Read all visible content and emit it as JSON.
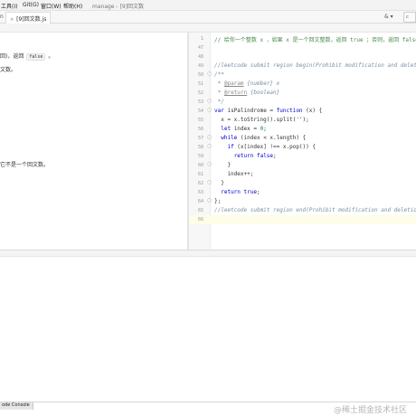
{
  "menubar": {
    "items": [
      "工具(I)",
      "Git(G)",
      "窗口(W)",
      "帮助(H)"
    ],
    "window_title": "manage - [9]回文数"
  },
  "tabbar": {
    "nav_arrow": "n",
    "active_tab": "[9]回文数.js",
    "user_menu": "&",
    "right_button": "c"
  },
  "description": {
    "line1_before": "回)，返回",
    "line1_code": "false",
    "line1_after": "。",
    "line2": "文数。",
    "line3": "它不是一个回文数。"
  },
  "editor": {
    "active_line_number": "66",
    "lines": [
      {
        "num": "1",
        "fold": false,
        "tokens": [
          {
            "t": "// 给你一个整数 x ，如果 x 是一个回文整数，返回 true ；否则，返回 false 。",
            "c": "tok-comment-cn"
          }
        ]
      },
      {
        "num": "47",
        "fold": false,
        "tokens": []
      },
      {
        "num": "48",
        "fold": false,
        "tokens": []
      },
      {
        "num": "49",
        "fold": false,
        "tokens": [
          {
            "t": "//leetcode submit region begin(Prohibit modification and deletion)",
            "c": "tok-comment"
          }
        ]
      },
      {
        "num": "50",
        "fold": true,
        "tokens": [
          {
            "t": "/**",
            "c": "tok-comment"
          }
        ]
      },
      {
        "num": "51",
        "fold": false,
        "tokens": [
          {
            "t": " * ",
            "c": "tok-comment"
          },
          {
            "t": "@param",
            "c": "tok-tag"
          },
          {
            "t": " {number} x",
            "c": "tok-comment"
          }
        ]
      },
      {
        "num": "52",
        "fold": false,
        "tokens": [
          {
            "t": " * ",
            "c": "tok-comment"
          },
          {
            "t": "@return",
            "c": "tok-tag"
          },
          {
            "t": " {boolean}",
            "c": "tok-comment"
          }
        ]
      },
      {
        "num": "53",
        "fold": true,
        "tokens": [
          {
            "t": " */",
            "c": "tok-comment"
          }
        ]
      },
      {
        "num": "54",
        "fold": true,
        "tokens": [
          {
            "t": "var ",
            "c": "tok-keyword"
          },
          {
            "t": "isPalindrome = ",
            "c": ""
          },
          {
            "t": "function ",
            "c": "tok-keyword"
          },
          {
            "t": "(x) {",
            "c": ""
          }
        ]
      },
      {
        "num": "55",
        "fold": false,
        "tokens": [
          {
            "t": "  x = x.toString().split(",
            "c": ""
          },
          {
            "t": "''",
            "c": "tok-string"
          },
          {
            "t": ");",
            "c": ""
          }
        ]
      },
      {
        "num": "56",
        "fold": false,
        "tokens": [
          {
            "t": "  ",
            "c": ""
          },
          {
            "t": "let ",
            "c": "tok-keyword"
          },
          {
            "t": "index = ",
            "c": ""
          },
          {
            "t": "0",
            "c": "tok-number"
          },
          {
            "t": ";",
            "c": ""
          }
        ]
      },
      {
        "num": "57",
        "fold": true,
        "tokens": [
          {
            "t": "  ",
            "c": ""
          },
          {
            "t": "while ",
            "c": "tok-keyword"
          },
          {
            "t": "(index < x.length) {",
            "c": ""
          }
        ]
      },
      {
        "num": "58",
        "fold": true,
        "tokens": [
          {
            "t": "    ",
            "c": ""
          },
          {
            "t": "if ",
            "c": "tok-keyword"
          },
          {
            "t": "(x[index] !== x.pop()) {",
            "c": ""
          }
        ]
      },
      {
        "num": "59",
        "fold": false,
        "tokens": [
          {
            "t": "      ",
            "c": ""
          },
          {
            "t": "return false",
            "c": "tok-keyword"
          },
          {
            "t": ";",
            "c": ""
          }
        ]
      },
      {
        "num": "60",
        "fold": true,
        "tokens": [
          {
            "t": "    }",
            "c": ""
          }
        ]
      },
      {
        "num": "61",
        "fold": false,
        "tokens": [
          {
            "t": "    index++;",
            "c": ""
          }
        ]
      },
      {
        "num": "62",
        "fold": true,
        "tokens": [
          {
            "t": "  }",
            "c": ""
          }
        ]
      },
      {
        "num": "63",
        "fold": false,
        "tokens": [
          {
            "t": "  ",
            "c": ""
          },
          {
            "t": "return true",
            "c": "tok-keyword"
          },
          {
            "t": ";",
            "c": ""
          }
        ]
      },
      {
        "num": "64",
        "fold": true,
        "tokens": [
          {
            "t": "};",
            "c": ""
          }
        ]
      },
      {
        "num": "65",
        "fold": false,
        "tokens": [
          {
            "t": "//leetcode submit region end(Prohibit modification and deletion)",
            "c": "tok-comment"
          }
        ]
      },
      {
        "num": "66",
        "fold": false,
        "tokens": []
      }
    ]
  },
  "statusbar": {
    "console_tab": "ode Console",
    "watermark": "@稀土掘金技术社区"
  }
}
